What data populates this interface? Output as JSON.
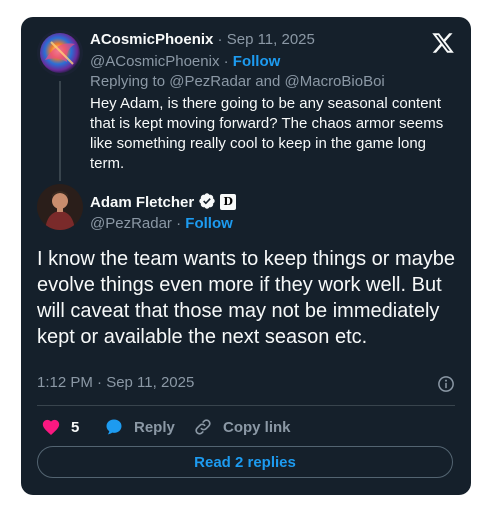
{
  "reply_tweet": {
    "display_name": "ACosmicPhoenix",
    "date_separator": " · ",
    "date": "Sep 11, 2025",
    "handle": "@ACosmicPhoenix",
    "handle_separator": " · ",
    "follow_label": "Follow",
    "replying_to": "Replying to @PezRadar and @MacroBioBoi",
    "text": "Hey Adam, is there going to be any seasonal content that is kept moving forward? The chaos armor seems like something really cool to keep in the game long term."
  },
  "main_tweet": {
    "display_name": "Adam Fletcher",
    "affiliation_badge": "D",
    "handle": "@PezRadar",
    "handle_separator": " · ",
    "follow_label": "Follow",
    "text": "I know the team wants to keep things or maybe evolve things even more if they work well. But will caveat that those may not be immediately kept or available the next season etc.",
    "timestamp": "1:12 PM · Sep 11, 2025"
  },
  "actions": {
    "like_count": "5",
    "reply_label": "Reply",
    "copy_link_label": "Copy link"
  },
  "read_replies_label": "Read 2 replies",
  "colors": {
    "card_background": "#15202b",
    "accent": "#1d9bf0",
    "like": "#f91880",
    "muted_text": "#8b98a5",
    "divider": "#38444d"
  },
  "icons": [
    "x-logo-icon",
    "verified-badge-icon",
    "info-icon",
    "heart-icon",
    "reply-bubble-icon",
    "link-icon"
  ]
}
